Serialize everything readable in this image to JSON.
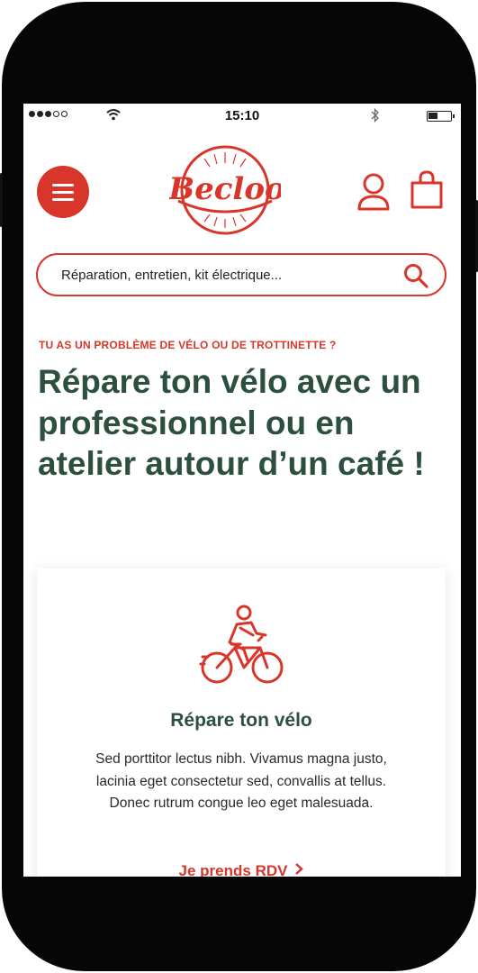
{
  "status_bar": {
    "time": "15:10"
  },
  "header": {
    "logo_text": "Becloo"
  },
  "search": {
    "placeholder": "Réparation, entretien, kit électrique..."
  },
  "hero": {
    "eyebrow": "TU AS UN PROBLÈME DE VÉLO OU DE TROTTINETTE  ?",
    "headline": "Répare ton vélo avec un professionnel ou en atelier autour d’un café !"
  },
  "card": {
    "icon": "cyclist-icon",
    "title": "Répare ton vélo",
    "text": "Sed porttitor lectus nibh. Vivamus magna justo, lacinia eget consectetur sed, convallis at tellus. Donec rutrum congue leo eget malesuada.",
    "link_label": "Je prends RDV"
  },
  "colors": {
    "accent": "#d9362b",
    "heading": "#2d4f3f",
    "frame": "#060606"
  }
}
